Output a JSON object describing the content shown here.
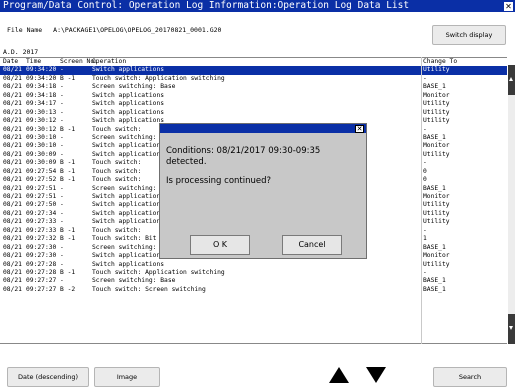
{
  "window": {
    "title": "Program/Data Control: Operation Log Information:Operation Log Data List"
  },
  "file": {
    "label": "File Name",
    "path": "A:\\PACKAGE1\\OPELOG\\OPELOG_20170821_0001.G20"
  },
  "buttons": {
    "switch_display": "Switch display",
    "date_descending": "Date (descending)",
    "image": "Image",
    "search": "Search"
  },
  "year_label": "A.D. 2017",
  "table": {
    "headers": {
      "date": "Date",
      "time": "Time",
      "screen_no": "Screen No.",
      "operation": "Operation",
      "change_to": "Change To"
    },
    "rows": [
      {
        "date": "08/21",
        "time": "09:34:20",
        "scr": "-",
        "op": "Switch applications",
        "chg": "Utility"
      },
      {
        "date": "08/21",
        "time": "09:34:20",
        "scr": "B -1",
        "op": "Touch switch: Application switching",
        "chg": "-"
      },
      {
        "date": "08/21",
        "time": "09:34:18",
        "scr": "-",
        "op": "Screen switching: Base",
        "chg": "BASE_1"
      },
      {
        "date": "08/21",
        "time": "09:34:18",
        "scr": "-",
        "op": "Switch applications",
        "chg": "Monitor"
      },
      {
        "date": "08/21",
        "time": "09:34:17",
        "scr": "-",
        "op": "Switch applications",
        "chg": "Utility"
      },
      {
        "date": "08/21",
        "time": "09:30:13",
        "scr": "-",
        "op": "Switch applications",
        "chg": "Utility"
      },
      {
        "date": "08/21",
        "time": "09:30:12",
        "scr": "-",
        "op": "Switch applications",
        "chg": "Utility"
      },
      {
        "date": "08/21",
        "time": "09:30:12",
        "scr": "B -1",
        "op": "Touch switch:",
        "chg": "-"
      },
      {
        "date": "08/21",
        "time": "09:30:10",
        "scr": "-",
        "op": "Screen switching:",
        "chg": "BASE_1"
      },
      {
        "date": "08/21",
        "time": "09:30:10",
        "scr": "-",
        "op": "Switch applications",
        "chg": "Monitor"
      },
      {
        "date": "08/21",
        "time": "09:30:09",
        "scr": "-",
        "op": "Switch applications",
        "chg": "Utility"
      },
      {
        "date": "08/21",
        "time": "09:30:09",
        "scr": "B -1",
        "op": "Touch switch:",
        "chg": "-"
      },
      {
        "date": "08/21",
        "time": "09:27:54",
        "scr": "B -1",
        "op": "Touch switch:",
        "chg": "0"
      },
      {
        "date": "08/21",
        "time": "09:27:52",
        "scr": "B -1",
        "op": "Touch switch:",
        "chg": "0"
      },
      {
        "date": "08/21",
        "time": "09:27:51",
        "scr": "-",
        "op": "Screen switching:",
        "chg": "BASE_1"
      },
      {
        "date": "08/21",
        "time": "09:27:51",
        "scr": "-",
        "op": "Switch applications",
        "chg": "Monitor"
      },
      {
        "date": "08/21",
        "time": "09:27:50",
        "scr": "-",
        "op": "Switch applications",
        "chg": "Utility"
      },
      {
        "date": "08/21",
        "time": "09:27:34",
        "scr": "-",
        "op": "Switch applications",
        "chg": "Utility"
      },
      {
        "date": "08/21",
        "time": "09:27:33",
        "scr": "-",
        "op": "Switch applications",
        "chg": "Utility"
      },
      {
        "date": "08/21",
        "time": "09:27:33",
        "scr": "B -1",
        "op": "Touch switch:",
        "chg": "-"
      },
      {
        "date": "08/21",
        "time": "09:27:32",
        "scr": "B -1",
        "op": "Touch switch: Bit ALT",
        "chg": "1"
      },
      {
        "date": "08/21",
        "time": "09:27:30",
        "scr": "-",
        "op": "Screen switching: Base",
        "chg": "BASE_1"
      },
      {
        "date": "08/21",
        "time": "09:27:30",
        "scr": "-",
        "op": "Switch applications",
        "chg": "Monitor"
      },
      {
        "date": "08/21",
        "time": "09:27:28",
        "scr": "-",
        "op": "Switch applications",
        "chg": "Utility"
      },
      {
        "date": "08/21",
        "time": "09:27:28",
        "scr": "B -1",
        "op": "Touch switch: Application switching",
        "chg": "-"
      },
      {
        "date": "08/21",
        "time": "09:27:27",
        "scr": "-",
        "op": "Screen switching: Base",
        "chg": "BASE_1"
      },
      {
        "date": "08/21",
        "time": "09:27:27",
        "scr": "B -2",
        "op": "Touch switch: Screen switching",
        "chg": "BASE_1"
      }
    ]
  },
  "dialog": {
    "line1": "Conditions: 08/21/2017 09:30-09:35",
    "line2": "detected.",
    "line3": "Is processing continued?",
    "ok_label": "O K",
    "cancel_label": "Cancel"
  },
  "colors": {
    "titlebar": "#0a2fa6",
    "selected_row": "#0a2fa6",
    "dialog_bg": "#c8c8c8"
  }
}
